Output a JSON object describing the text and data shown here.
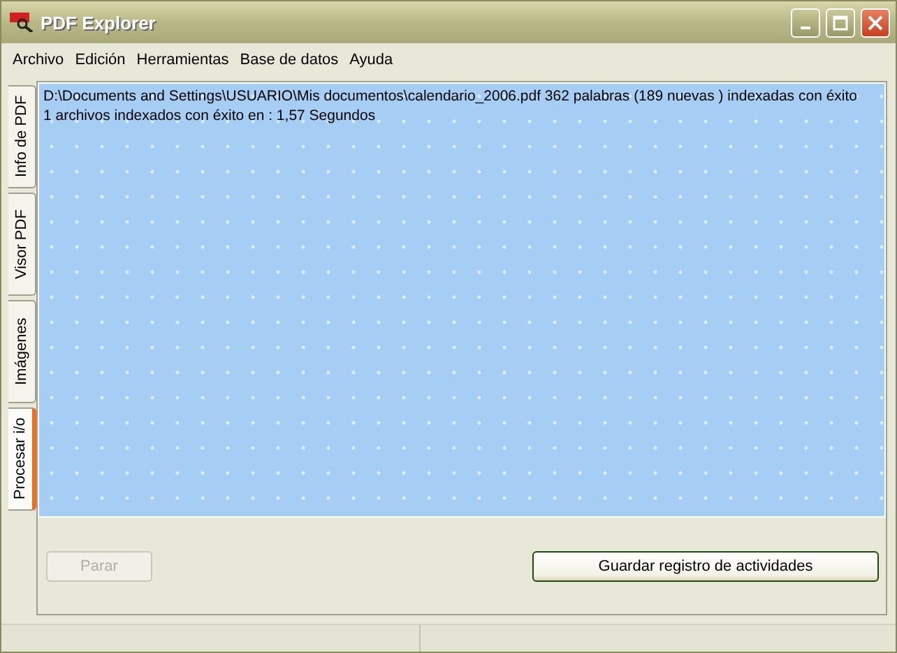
{
  "window": {
    "title": "PDF Explorer"
  },
  "menu": [
    "Archivo",
    "Edición",
    "Herramientas",
    "Base de datos",
    "Ayuda"
  ],
  "tabs": [
    {
      "label": "Info de PDF",
      "selected": false
    },
    {
      "label": "Visor PDF",
      "selected": false
    },
    {
      "label": "Imágenes",
      "selected": false
    },
    {
      "label": "Procesar i/o",
      "selected": true
    }
  ],
  "log": [
    "D:\\Documents and Settings\\USUARIO\\Mis documentos\\calendario_2006.pdf 362 palabras (189 nuevas ) indexadas con éxito",
    "1 archivos indexados con éxito en : 1,57 Segundos"
  ],
  "buttons": [
    {
      "label": "Parar",
      "disabled": true
    },
    {
      "label": "Guardar registro de actividades",
      "disabled": false
    }
  ]
}
